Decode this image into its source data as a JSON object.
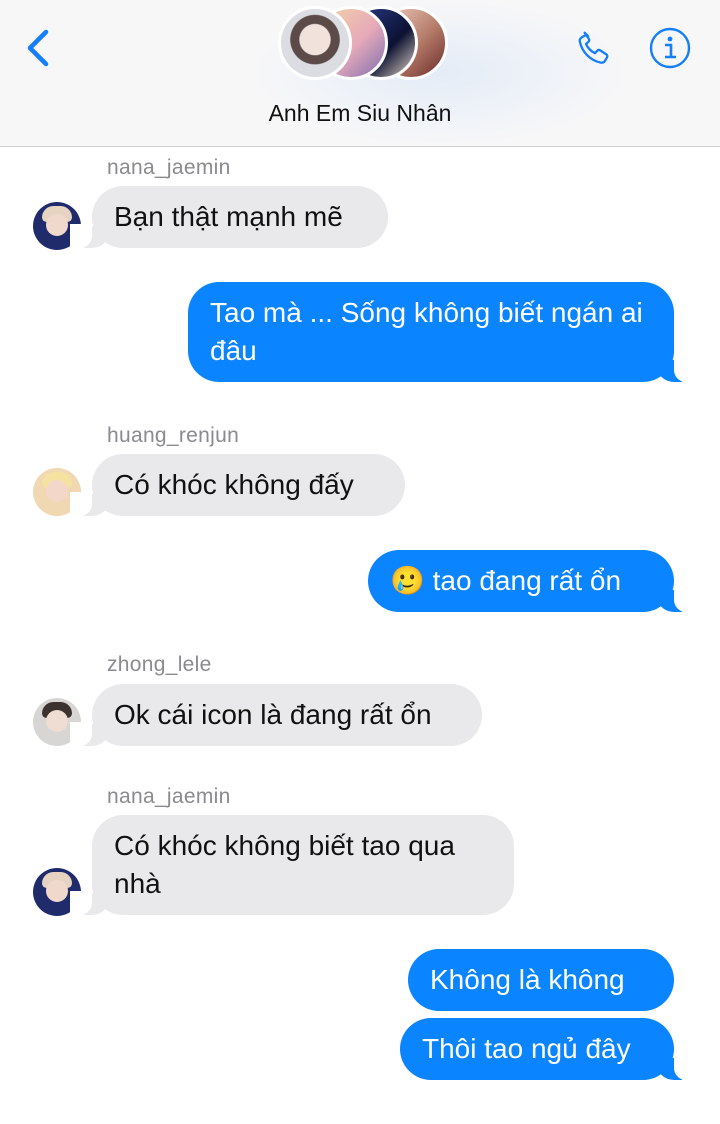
{
  "header": {
    "group_name": "Anh Em Siu Nhân",
    "icons": {
      "back": "chevron-left-icon",
      "call": "phone-icon",
      "info": "info-icon"
    }
  },
  "messages": [
    {
      "sender": "nana_jaemin",
      "direction": "incoming",
      "text": "Bạn thật mạnh mẽ"
    },
    {
      "direction": "outgoing",
      "text": "Tao mà ... Sống không biết ngán ai đâu"
    },
    {
      "sender": "huang_renjun",
      "direction": "incoming",
      "text": "Có khóc không đấy"
    },
    {
      "direction": "outgoing",
      "emoji": "🥲",
      "text": "tao đang rất ổn"
    },
    {
      "sender": "zhong_lele",
      "direction": "incoming",
      "text": "Ok cái icon là đang rất ổn"
    },
    {
      "sender": "nana_jaemin",
      "direction": "incoming",
      "text": "Có khóc không biết tao qua nhà"
    },
    {
      "direction": "outgoing",
      "text": "Không là không"
    },
    {
      "direction": "outgoing",
      "text": "Thôi tao ngủ đây"
    }
  ],
  "colors": {
    "outgoing_bubble": "#0a84ff",
    "incoming_bubble": "#e9e9eb",
    "accent": "#147efb",
    "sender_label": "#8a8a8f"
  }
}
